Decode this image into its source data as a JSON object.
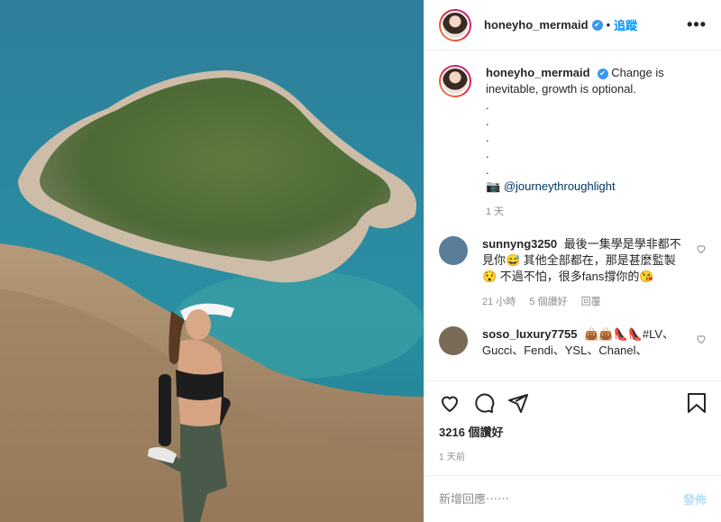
{
  "header": {
    "username": "honeyho_mermaid",
    "verified_icon": "verified-badge-icon",
    "separator": "•",
    "follow_label": "追蹤",
    "more_label": "•••"
  },
  "caption": {
    "username": "honeyho_mermaid",
    "text": "Change is inevitable, growth is optional.",
    "dots": [
      ".",
      ".",
      ".",
      ".",
      "."
    ],
    "camera_glyph": "📷",
    "mention": "@journeythroughlight",
    "time": "1 天"
  },
  "comments": [
    {
      "username": "sunnyng3250",
      "text": "最後一集學是學非都不見你😅 其他全部都在，那是甚麼監製😯 不過不怕，很多fans撐你的😘",
      "time": "21 小時",
      "likes": "5 個讚好",
      "reply": "回覆"
    },
    {
      "username": "soso_luxury7755",
      "text": "👜👜👠👠#LV、Gucci、Fendi、YSL、Chanel、",
      "time": "",
      "likes": "",
      "reply": ""
    }
  ],
  "actions": {
    "likes": "3216 個讚好",
    "time": "1 天前"
  },
  "add_comment": {
    "placeholder": "新增回應⋯⋯",
    "post_label": "發佈"
  },
  "colors": {
    "accent": "#0095f6",
    "post_disabled": "#b2dffc",
    "meta_gray": "#8e8e8e"
  }
}
